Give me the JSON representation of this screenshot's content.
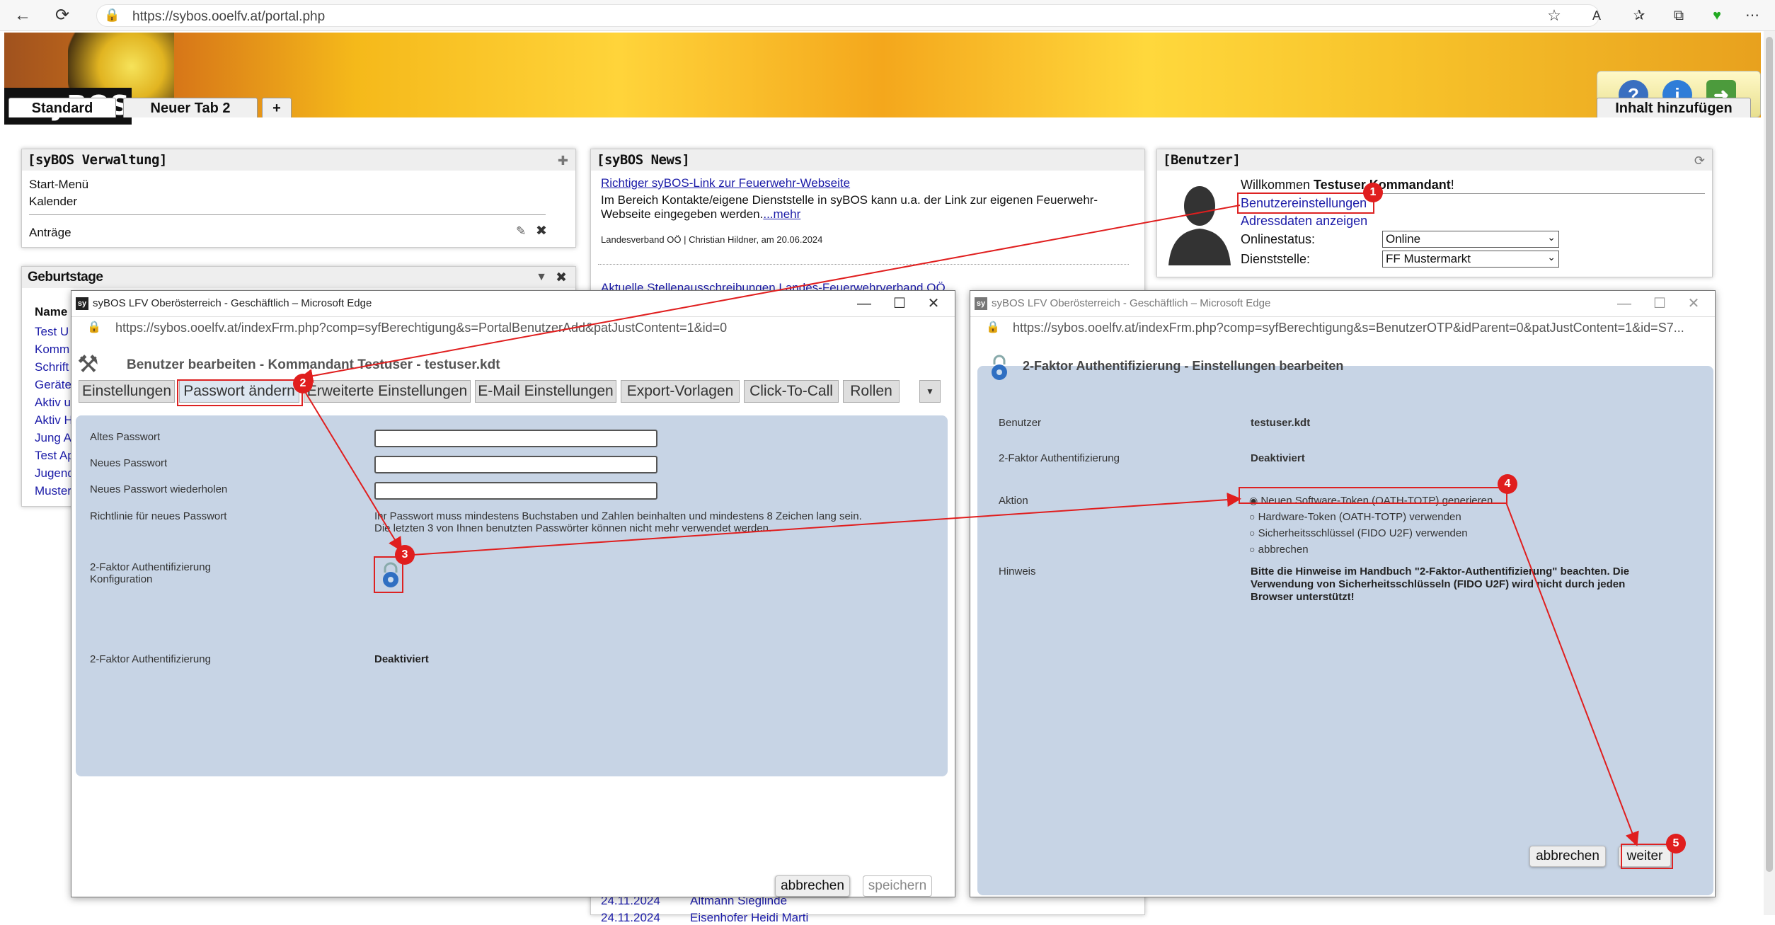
{
  "browser": {
    "url": "https://sybos.ooelfv.at/portal.php"
  },
  "app": {
    "logo": "syBOS",
    "logo_bars": "///"
  },
  "tabs": [
    {
      "label": "Standard"
    },
    {
      "label": "Neuer Tab 2"
    },
    {
      "label": "+"
    },
    {
      "label": "Inhalt hinzufügen"
    }
  ],
  "verwaltung": {
    "title": "[syBOS Verwaltung]",
    "items": [
      "Start-Menü",
      "Kalender",
      "Anträge"
    ]
  },
  "geburtstage": {
    "title": "Geburtstage",
    "col": "Name",
    "rows": [
      "Test U",
      "Komm",
      "Schrift",
      "Geräte",
      "Aktiv u",
      "Aktiv H",
      "Jung A",
      "Test Ap",
      "Jugend",
      "Muster"
    ]
  },
  "news": {
    "title": "[syBOS News]",
    "item1_title": "Richtiger syBOS-Link zur Feuerwehr-Webseite",
    "item1_text": "Im Bereich Kontakte/eigene Dienststelle in syBOS kann u.a. der Link zur eigenen Feuerwehr-Webseite eingegeben werden.",
    "item1_more": "...mehr",
    "item1_meta": "Landesverband OÖ | Christian Hildner, am 20.06.2024",
    "item2_title": "Aktuelle Stellenausschreibungen Landes-Feuerwehrverband OÖ",
    "row1_date": "24.11.2024",
    "row1_name": "Altmann Sieglinde",
    "row2_date": "24.11.2024",
    "row2_name": "Eisenhofer Heidi Marti"
  },
  "benutzer": {
    "title": "[Benutzer]",
    "welcome_pre": "Willkommen ",
    "welcome_name": "Testuser Kommandant",
    "welcome_post": "!",
    "link1": "Benutzereinstellungen",
    "link2": "Adressdaten anzeigen",
    "status_label": "Onlinestatus:",
    "status_value": "Online",
    "dienst_label": "Dienststelle:",
    "dienst_value": "FF Mustermarkt"
  },
  "win1": {
    "title": "syBOS LFV Oberösterreich - Geschäftlich – Microsoft Edge",
    "url": "https://sybos.ooelfv.at/indexFrm.php?comp=syfBerechtigung&s=PortalBenutzerAdd&patJustContent=1&id=0",
    "heading": "Benutzer bearbeiten - Kommandant Testuser - testuser.kdt",
    "tabs": [
      "Einstellungen",
      "Passwort ändern",
      "Erweiterte Einstellungen",
      "E-Mail Einstellungen",
      "Export-Vorlagen",
      "Click-To-Call",
      "Rollen"
    ],
    "f_old": "Altes Passwort",
    "f_new": "Neues Passwort",
    "f_rep": "Neues Passwort wiederholen",
    "f_rule": "Richtlinie für neues Passwort",
    "rule_text1": "Ihr Passwort muss mindestens Buchstaben und Zahlen beinhalten und mindestens 8 Zeichen lang sein.",
    "rule_text2": "Die letzten 3 von Ihnen benutzten Passwörter können nicht mehr verwendet werden.",
    "f_2fa_cfg1": "2-Faktor Authentifizierung",
    "f_2fa_cfg2": "Konfiguration",
    "f_2fa": "2-Faktor Authentifizierung",
    "v_2fa": "Deaktiviert",
    "btn_cancel": "abbrechen",
    "btn_save": "speichern"
  },
  "win2": {
    "title": "syBOS LFV Oberösterreich - Geschäftlich – Microsoft Edge",
    "url": "https://sybos.ooelfv.at/indexFrm.php?comp=syfBerechtigung&s=BenutzerOTP&idParent=0&patJustContent=1&id=S7...",
    "heading": "2-Faktor Authentifizierung - Einstellungen bearbeiten",
    "l_user": "Benutzer",
    "v_user": "testuser.kdt",
    "l_2fa": "2-Faktor Authentifizierung",
    "v_2fa": "Deaktiviert",
    "l_action": "Aktion",
    "options": [
      "Neuen Software-Token (OATH-TOTP) generieren",
      "Hardware-Token (OATH-TOTP) verwenden",
      "Sicherheitsschlüssel (FIDO U2F) verwenden",
      "abbrechen"
    ],
    "l_hint": "Hinweis",
    "hint": "Bitte die Hinweise im Handbuch \"2-Faktor-Authentifizierung\" beachten. Die Verwendung von Sicherheitsschlüsseln (FIDO U2F) wird nicht durch jeden Browser unterstützt!",
    "btn_cancel": "abbrechen",
    "btn_next": "weiter"
  },
  "annotations": [
    "1",
    "2",
    "3",
    "4",
    "5"
  ],
  "colors": {
    "annotation": "#e01e1e",
    "panel_blue": "#c7d4e5",
    "link": "#1b1ba8"
  }
}
